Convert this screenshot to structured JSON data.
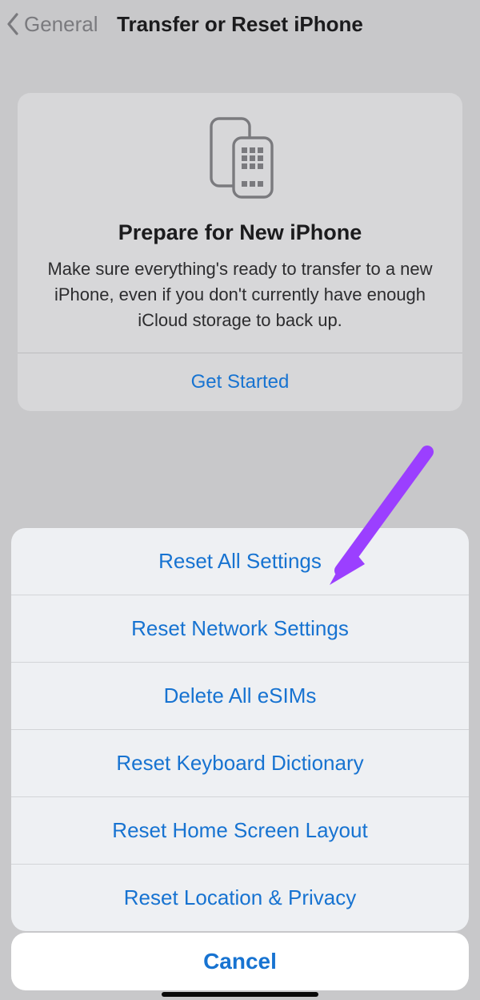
{
  "nav": {
    "back_label": "General",
    "title": "Transfer or Reset iPhone"
  },
  "card": {
    "title": "Prepare for New iPhone",
    "description": "Make sure everything's ready to transfer to a new iPhone, even if you don't currently have enough iCloud storage to back up.",
    "cta": "Get Started"
  },
  "sheet": {
    "items": [
      "Reset All Settings",
      "Reset Network Settings",
      "Delete All eSIMs",
      "Reset Keyboard Dictionary",
      "Reset Home Screen Layout",
      "Reset Location & Privacy"
    ],
    "cancel": "Cancel"
  },
  "colors": {
    "link": "#1773d1",
    "arrow": "#9b3fff"
  }
}
